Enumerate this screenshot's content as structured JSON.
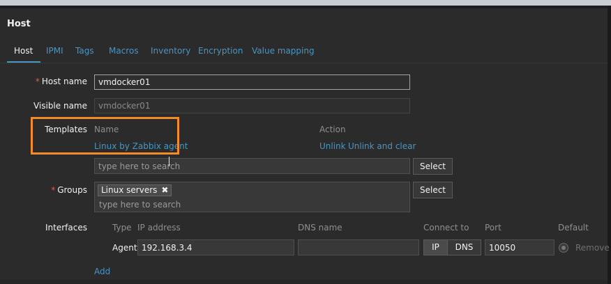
{
  "dialog": {
    "title": "Host"
  },
  "tabs": [
    {
      "label": "Host",
      "active": true
    },
    {
      "label": "IPMI"
    },
    {
      "label": "Tags"
    },
    {
      "label": "Macros"
    },
    {
      "label": "Inventory"
    },
    {
      "label": "Encryption"
    },
    {
      "label": "Value mapping"
    }
  ],
  "form": {
    "required_mark": "*",
    "host_name": {
      "label": "Host name",
      "value": "vmdocker01"
    },
    "visible_name": {
      "label": "Visible name",
      "value": "vmdocker01"
    },
    "templates": {
      "label": "Templates",
      "col_name": "Name",
      "col_action": "Action",
      "linked": [
        {
          "name": "Linux by Zabbix agent",
          "unlink": "Unlink",
          "unlink_clear": "Unlink and clear"
        }
      ],
      "search_placeholder": "type here to search",
      "select_label": "Select"
    },
    "groups": {
      "label": "Groups",
      "chips": [
        {
          "name": "Linux servers",
          "remove": "✖"
        }
      ],
      "search_placeholder": "type here to search",
      "select_label": "Select"
    },
    "interfaces": {
      "label": "Interfaces",
      "headers": {
        "type": "Type",
        "ip": "IP address",
        "dns": "DNS name",
        "connect": "Connect to",
        "port": "Port",
        "default": "Default"
      },
      "rows": [
        {
          "type": "Agent",
          "ip": "192.168.3.4",
          "dns": "",
          "connect_ip": "IP",
          "connect_dns": "DNS",
          "connect_selected": "IP",
          "port": "10050",
          "remove": "Remove"
        }
      ],
      "add_label": "Add"
    }
  },
  "colors": {
    "background": "#2b2b2b",
    "link": "#4796c4",
    "required": "#e45959",
    "highlight": "#f58a2a"
  }
}
